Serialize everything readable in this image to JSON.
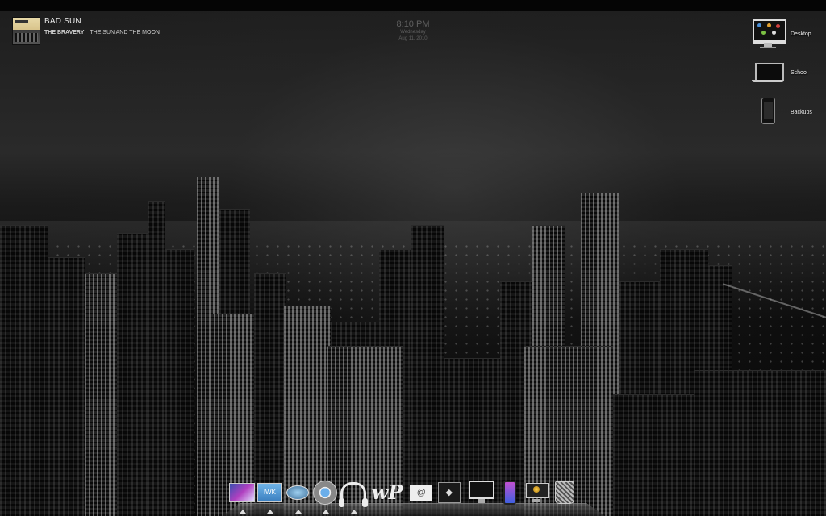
{
  "now_playing": {
    "track": "BAD SUN",
    "artist": "THE BRAVERY",
    "album": "THE SUN AND THE MOON"
  },
  "clock": {
    "time": "8:10 PM",
    "day": "Wednesday",
    "date": "Aug 11, 2010"
  },
  "desktop_icons": [
    {
      "label": "Desktop",
      "icon": "imac-icon"
    },
    {
      "label": "School",
      "icon": "macbook-icon"
    },
    {
      "label": "Backups",
      "icon": "iphone-icon"
    }
  ],
  "dock": {
    "items": [
      {
        "name": "itunes-visualizer-icon",
        "glyph": ""
      },
      {
        "name": "iwork-icon",
        "glyph": ""
      },
      {
        "name": "safari-icon",
        "glyph": ""
      },
      {
        "name": "chrome-icon",
        "glyph": ""
      },
      {
        "name": "headphones-icon",
        "glyph": "🎧"
      },
      {
        "name": "wordpress-icon",
        "glyph": "wp"
      },
      {
        "name": "mail-icon",
        "glyph": "@"
      },
      {
        "name": "app-icon",
        "glyph": "◆"
      },
      {
        "name": "imac-icon",
        "glyph": ""
      },
      {
        "name": "iphone-icon",
        "glyph": ""
      },
      {
        "name": "macbook-icon",
        "glyph": ""
      },
      {
        "name": "trash-icon",
        "glyph": ""
      }
    ]
  },
  "colors": {
    "text": "#e8e8e8",
    "dock_indicator": "#dddddd"
  }
}
